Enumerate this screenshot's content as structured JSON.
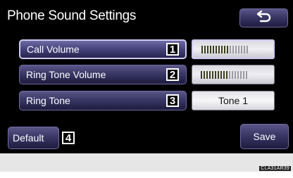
{
  "header": {
    "title": "Phone Sound Settings",
    "back_icon": "return-arrow-icon"
  },
  "settings": [
    {
      "label": "Call Volume",
      "number": "1",
      "selected": true,
      "volume_level": 0.59
    },
    {
      "label": "Ring Tone Volume",
      "number": "2",
      "selected": false,
      "volume_level": 0.59
    },
    {
      "label": "Ring Tone",
      "number": "3",
      "selected": false,
      "value": "Tone 1"
    }
  ],
  "footer": {
    "default_label": "Default",
    "default_number": "4",
    "save_label": "Save"
  },
  "image_code": "CLA31AR39",
  "colors": {
    "background": "#000000",
    "button": "#3a3766",
    "selected_border": "#cfcbf2",
    "meter_bg": "#e8e8ee"
  }
}
